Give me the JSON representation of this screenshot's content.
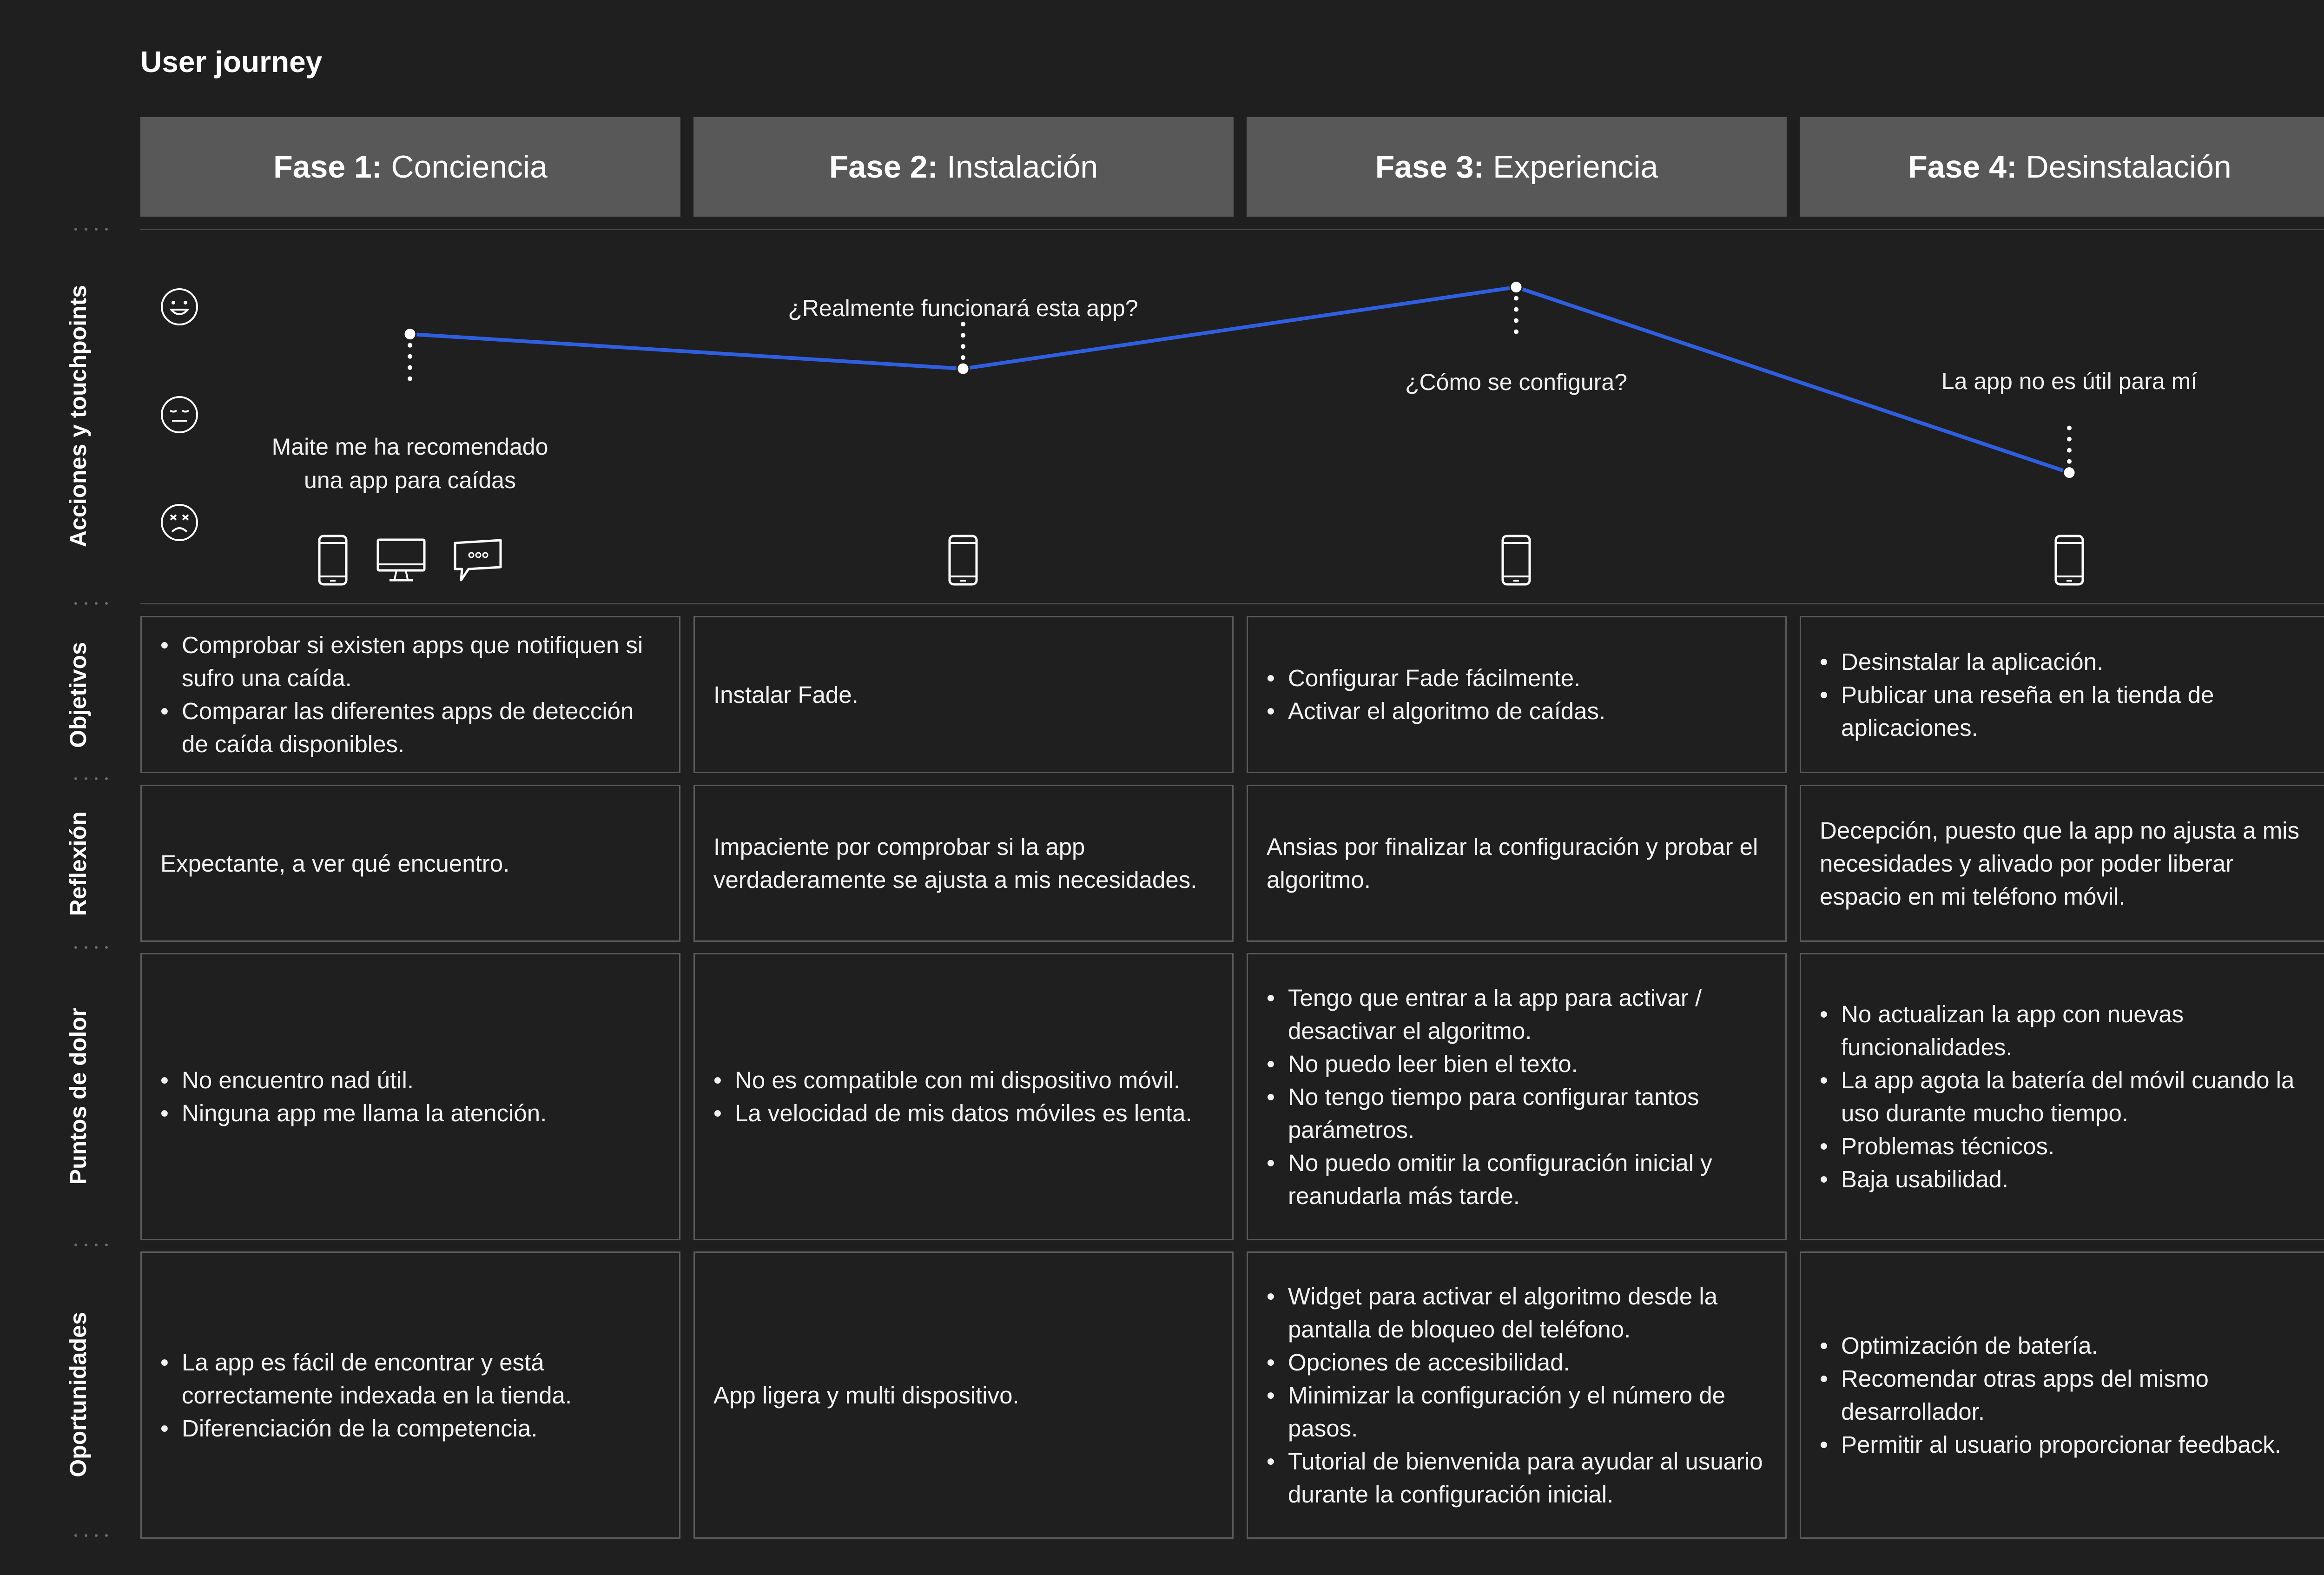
{
  "title": "User journey",
  "phases": [
    {
      "label": "Fase 1",
      "name": "Conciencia"
    },
    {
      "label": "Fase 2",
      "name": "Instalación"
    },
    {
      "label": "Fase 3",
      "name": "Experiencia"
    },
    {
      "label": "Fase 4",
      "name": "Desinstalación"
    }
  ],
  "row_labels": {
    "acciones": "Acciones y touchpoints",
    "objetivos": "Objetivos",
    "reflexion": "Reflexión",
    "puntos": "Puntos de dolor",
    "oportunidades": "Oportunidades"
  },
  "emotions": [
    "happy-face-icon",
    "neutral-face-icon",
    "angry-face-icon"
  ],
  "journey": {
    "line_color": "#2f5fe0",
    "points": [
      {
        "phase": 1,
        "level": 0.76,
        "text_lines": [
          "Maite me ha recomendado",
          "una app para caídas"
        ],
        "devices": [
          "phone-icon",
          "desktop-icon",
          "chat-bubble-icon"
        ]
      },
      {
        "phase": 2,
        "level": 0.62,
        "text_lines": [
          "¿Realmente funcionará esta app?"
        ],
        "devices": [
          "phone-icon"
        ]
      },
      {
        "phase": 3,
        "level": 0.95,
        "text_lines": [
          "¿Cómo se configura?"
        ],
        "devices": [
          "phone-icon"
        ]
      },
      {
        "phase": 4,
        "level": 0.2,
        "text_lines": [
          "La app no es útil para mí"
        ],
        "devices": [
          "phone-icon"
        ]
      }
    ]
  },
  "objetivos": [
    [
      "Comprobar si existen apps que notifiquen si sufro una caída.",
      "Comparar las diferentes apps de detección de caída disponibles."
    ],
    "Instalar Fade.",
    [
      "Configurar Fade fácilmente.",
      "Activar el algoritmo de caídas."
    ],
    [
      "Desinstalar la aplicación.",
      "Publicar una reseña en la tienda de aplicaciones."
    ]
  ],
  "reflexion": [
    "Expectante, a ver qué encuentro.",
    "Impaciente por comprobar si la app verdaderamente se ajusta a mis necesidades.",
    "Ansias por finalizar la configuración y probar el algoritmo.",
    "Decepción, puesto que la app no ajusta a mis necesidades y alivado por poder liberar espacio en mi teléfono móvil."
  ],
  "puntos_de_dolor": [
    [
      "No encuentro nad útil.",
      "Ninguna app me llama la atención."
    ],
    [
      "No es compatible con mi dispositivo móvil.",
      "La velocidad de mis datos móviles es lenta."
    ],
    [
      "Tengo que entrar a la app para activar / desactivar el algoritmo.",
      "No puedo leer bien el texto.",
      "No tengo tiempo para configurar tantos parámetros.",
      "No puedo omitir la configuración inicial y reanudarla más tarde."
    ],
    [
      "No actualizan la app con nuevas funcionalidades.",
      "La app agota la batería del móvil cuando la uso durante mucho tiempo.",
      "Problemas técnicos.",
      "Baja usabilidad."
    ]
  ],
  "oportunidades": [
    [
      "La app es fácil de encontrar y está correctamente indexada en la tienda.",
      "Diferenciación de la competencia."
    ],
    "App ligera y multi dispositivo.",
    [
      "Widget para activar el algoritmo desde la pantalla de bloqueo del teléfono.",
      "Opciones de accesibilidad.",
      "Minimizar la configuración y el número de pasos.",
      "Tutorial de bienvenida para ayudar al usuario durante la configuración inicial."
    ],
    [
      "Optimización de batería.",
      "Recomendar otras apps del mismo desarrollador.",
      "Permitir al usuario proporcionar feedback."
    ]
  ]
}
